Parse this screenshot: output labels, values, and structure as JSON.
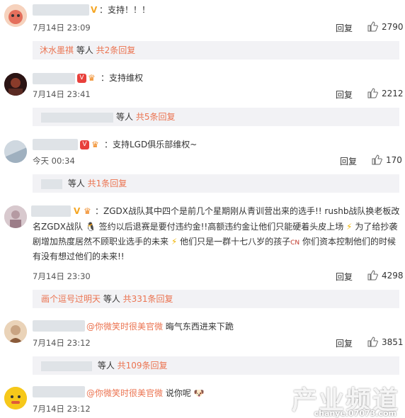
{
  "reply_label": "回复",
  "comments": [
    {
      "text": "：支持！！！",
      "time": "7月14日 23:09",
      "likes": "2790",
      "sub_user": "沐水墨祺",
      "sub_mid": " 等人 ",
      "sub_more": "共2条回复"
    },
    {
      "text": "：支持维权",
      "time": "7月14日 23:41",
      "likes": "2212",
      "sub_mid": "等人 ",
      "sub_more": "共5条回复"
    },
    {
      "text": "：支持LGD俱乐部维权~",
      "time": "今天 00:34",
      "likes": "170",
      "sub_mid": " 等人 ",
      "sub_more": "共1条回复"
    },
    {
      "line1": "：ZGDX战队其中四个是前几个星期刚从青训营出来的选手!! rushb战队换老板改",
      "line2": "名ZGDX战队",
      "line2b": "签约以后退赛是要付违约金!!高额违约金让他们只能硬着头皮上场",
      "line2c": "为了给抄袭",
      "line3": "剧增加热度居然不顾职业选手的未来",
      "line3b": "他们只是一群十七八岁的孩子",
      "line3c": "你们资本控制他们的时候",
      "line4": "有没有想过他们的未来!!",
      "cn_label": "CN",
      "time": "7月14日 23:30",
      "likes": "4298",
      "sub_user": "画个逗号过明天",
      "sub_mid": " 等人 ",
      "sub_more": "共331条回复"
    },
    {
      "mention": "@你微笑时很美官微",
      "text": " 晦气东西进来下跪",
      "time": "7月14日 23:12",
      "likes": "3851",
      "sub_mid": " 等人 ",
      "sub_more": "共109条回复"
    },
    {
      "mention": "@你微笑时很美官微",
      "text": " 说你呢",
      "time": "7月14日 23:12"
    }
  ],
  "watermark": {
    "main": "产业频道",
    "sub": "chanye.07073.com"
  }
}
